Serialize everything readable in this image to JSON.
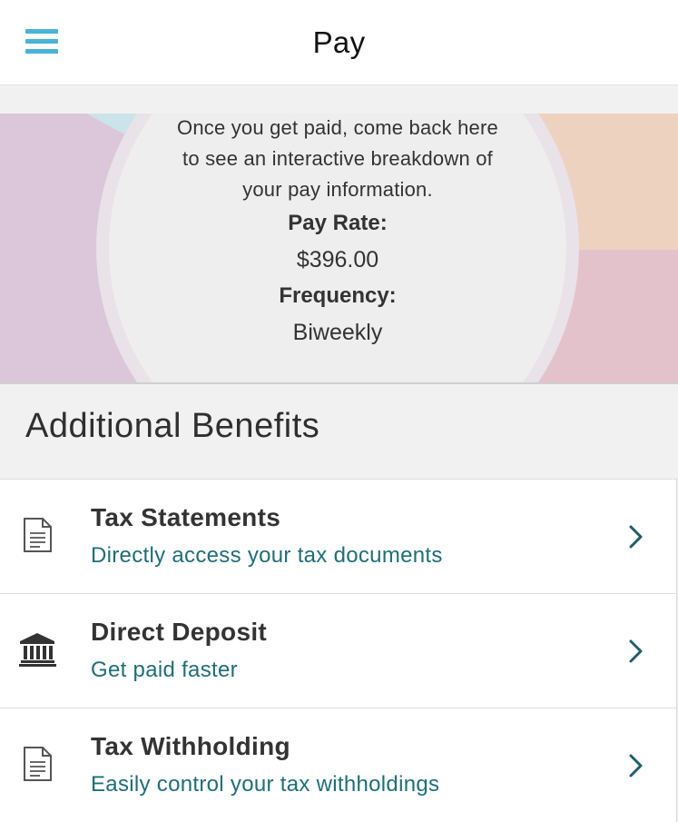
{
  "header": {
    "title": "Pay",
    "menu_icon": "hamburger-menu-icon"
  },
  "colors": {
    "accent": "#4ab3d8",
    "link_teal": "#1f6e78",
    "chart_lavender": "#dcc6d9",
    "chart_peach": "#edd3bf",
    "chart_pink": "#e4c2cc",
    "chart_blue": "#cbe3ea",
    "chart_center": "#eeeeee"
  },
  "pay_summary": {
    "message": "Once you get paid, come back here to see an interactive breakdown of your pay information.",
    "pay_rate_label": "Pay Rate:",
    "pay_rate_value": "$396.00",
    "frequency_label": "Frequency:",
    "frequency_value": "Biweekly"
  },
  "benefits_section": {
    "title": "Additional Benefits",
    "items": [
      {
        "title": "Tax Statements",
        "subtitle": "Directly access your tax documents",
        "icon": "document-icon"
      },
      {
        "title": "Direct Deposit",
        "subtitle": "Get paid faster",
        "icon": "bank-icon"
      },
      {
        "title": "Tax Withholding",
        "subtitle": "Easily control your tax withholdings",
        "icon": "document-icon"
      }
    ]
  }
}
